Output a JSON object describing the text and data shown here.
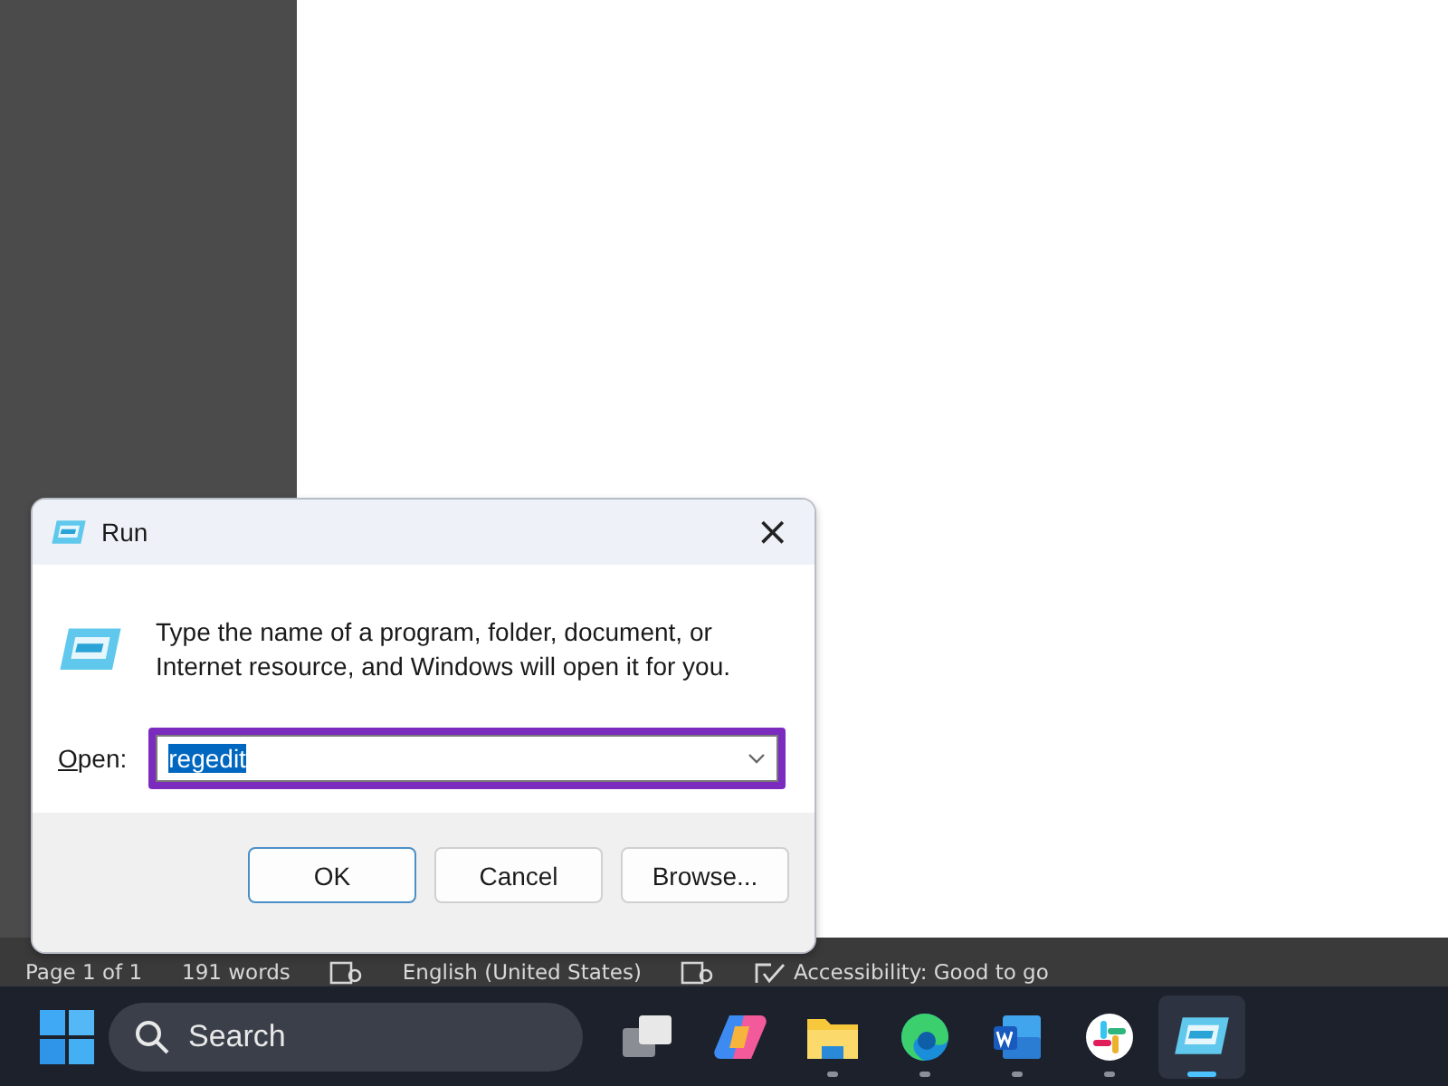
{
  "status_bar": {
    "items": [
      {
        "kind": "text",
        "text": "Page 1 of 1"
      },
      {
        "kind": "text",
        "text": "191 words"
      },
      {
        "kind": "icon"
      },
      {
        "kind": "text",
        "text": "English (United States)"
      },
      {
        "kind": "icon"
      },
      {
        "kind": "check",
        "text": "Accessibility: Good to go"
      }
    ]
  },
  "dialog": {
    "title": "Run",
    "close": "×",
    "message": "Type the name of a program, folder, document, or Internet resource, and Windows will open it for you.",
    "open_label": "Open:",
    "value": "regedit",
    "value_selected": true,
    "highlighted": true,
    "buttons": [
      {
        "label": "OK",
        "default": true
      },
      {
        "label": "Cancel",
        "default": false
      },
      {
        "label": "Browse...",
        "default": false
      }
    ]
  },
  "taskbar": {
    "search_placeholder": "Search",
    "apps": [
      {
        "kind": "taskview",
        "running": false,
        "active": false
      },
      {
        "kind": "copilot",
        "running": false,
        "active": false
      },
      {
        "kind": "explorer",
        "running": true,
        "active": false
      },
      {
        "kind": "edge",
        "running": true,
        "active": false
      },
      {
        "kind": "word",
        "running": true,
        "active": false
      },
      {
        "kind": "slack",
        "running": true,
        "active": false
      },
      {
        "kind": "run",
        "running": true,
        "active": true
      }
    ]
  }
}
